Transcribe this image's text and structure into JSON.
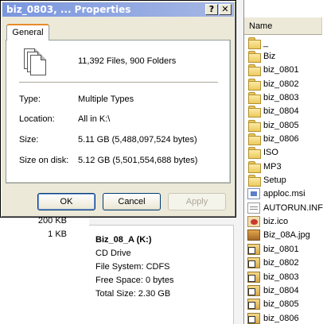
{
  "dialog": {
    "title": "biz_0803, ... Properties",
    "help_glyph": "?",
    "close_glyph": "✕",
    "tab_general": "General",
    "summary": "11,392 Files, 900 Folders",
    "type_label": "Type:",
    "type_value": "Multiple Types",
    "location_label": "Location:",
    "location_value": "All in K:\\",
    "size_label": "Size:",
    "size_value": "5.11 GB (5,488,097,524 bytes)",
    "size_on_disk_label": "Size on disk:",
    "size_on_disk_value": "5.12 GB (5,501,554,688 bytes)",
    "ok": "OK",
    "cancel": "Cancel",
    "apply": "Apply"
  },
  "left_sizes": [
    "200 KB",
    "1 KB"
  ],
  "drive": {
    "title": "Biz_08_A (K:)",
    "type": "CD Drive",
    "file_system": "File System: CDFS",
    "free_space": "Free Space: 0 bytes",
    "total_size": "Total Size: 2.30 GB"
  },
  "file_panel": {
    "column_header": "Name",
    "items": [
      {
        "name": "_",
        "icon": "folder-icon"
      },
      {
        "name": "Biz",
        "icon": "folder-icon"
      },
      {
        "name": "biz_0801",
        "icon": "folder-icon"
      },
      {
        "name": "biz_0802",
        "icon": "folder-icon"
      },
      {
        "name": "biz_0803",
        "icon": "folder-icon"
      },
      {
        "name": "biz_0804",
        "icon": "folder-icon"
      },
      {
        "name": "biz_0805",
        "icon": "folder-icon"
      },
      {
        "name": "biz_0806",
        "icon": "folder-icon"
      },
      {
        "name": "ISO",
        "icon": "folder-icon"
      },
      {
        "name": "MP3",
        "icon": "folder-icon"
      },
      {
        "name": "Setup",
        "icon": "folder-icon"
      },
      {
        "name": "apploc.msi",
        "icon": "msi-file-icon"
      },
      {
        "name": "AUTORUN.INF",
        "icon": "inf-file-icon"
      },
      {
        "name": "biz.ico",
        "icon": "ico-file-icon"
      },
      {
        "name": "Biz_08A.jpg",
        "icon": "jpg-file-icon"
      },
      {
        "name": "biz_0801",
        "icon": "shortcut-icon"
      },
      {
        "name": "biz_0802",
        "icon": "shortcut-icon"
      },
      {
        "name": "biz_0803",
        "icon": "shortcut-icon"
      },
      {
        "name": "biz_0804",
        "icon": "shortcut-icon"
      },
      {
        "name": "biz_0805",
        "icon": "shortcut-icon"
      },
      {
        "name": "biz_0806",
        "icon": "shortcut-icon"
      }
    ]
  },
  "colors": {
    "titlebar_start": "#7a96df",
    "titlebar_end": "#a6b8e4",
    "tab_highlight": "#e68b2c",
    "button_border": "#003c74",
    "window_bg": "#ece9d8"
  }
}
